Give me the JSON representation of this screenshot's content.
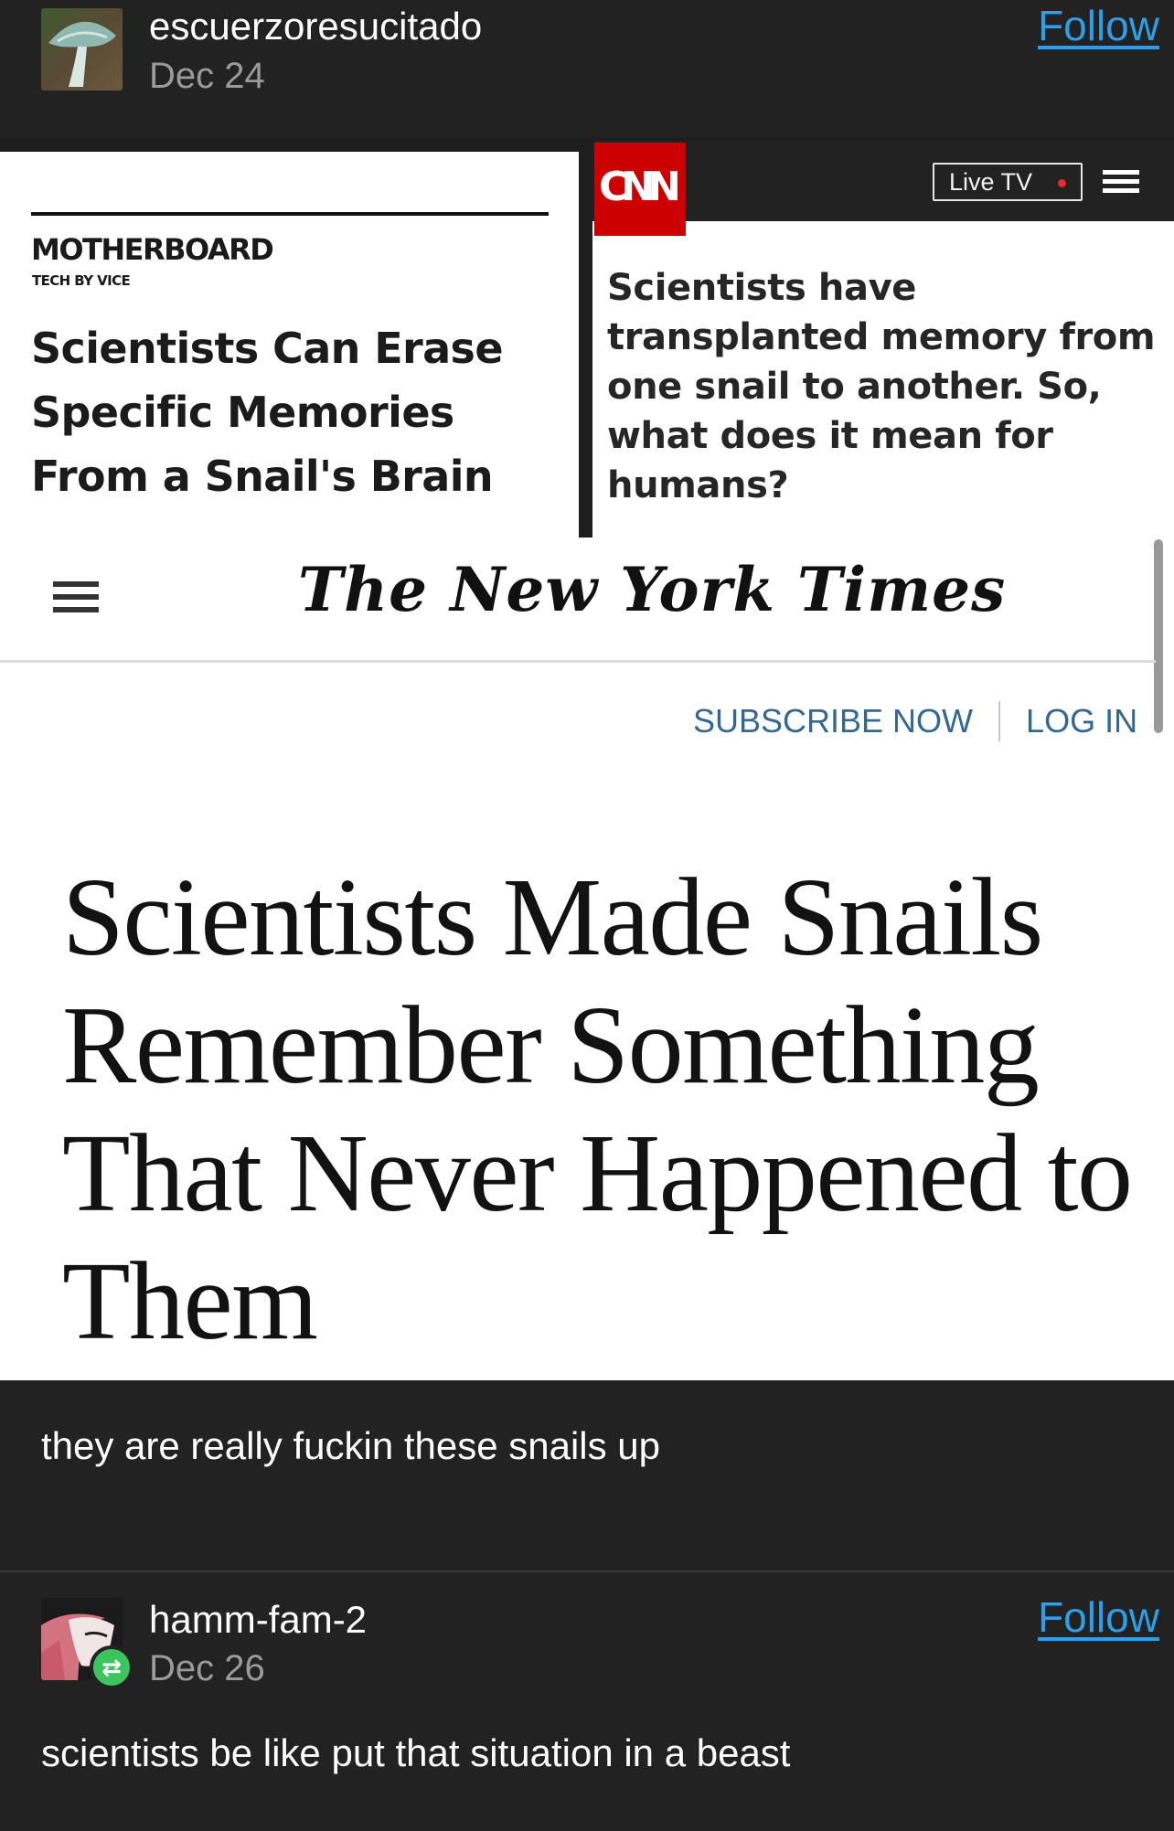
{
  "post": {
    "username": "escuerzoresucitado",
    "date": "Dec 24",
    "follow_label": "Follow"
  },
  "motherboard": {
    "logo": "MOTHERBOARD",
    "sublogo": "TECH BY VICE",
    "headline": "Scientists Can Erase Specific Memories From a Snail's Brain"
  },
  "cnn": {
    "logo": "CNN",
    "live_tv_label": "Live TV",
    "headline": "Scientists have transplanted memory from one snail to another. So, what does it mean for humans?"
  },
  "nyt": {
    "logo": "The New York Times",
    "subscribe_label": "SUBSCRIBE NOW",
    "login_label": "LOG IN",
    "headline": "Scientists Made Snails Remember Something That Never Happened to Them"
  },
  "caption": "they are really fuckin these snails up",
  "reblog": {
    "username": "hamm-fam-2",
    "date": "Dec 26",
    "follow_label": "Follow",
    "comment": "scientists be like put that situation in a beast"
  },
  "colors": {
    "background": "#222222",
    "follow_link": "#2f9ee8",
    "cnn_red": "#cc0000",
    "nyt_link": "#326891",
    "reblog_green": "#3cc55e"
  },
  "icons": [
    "mushroom-avatar",
    "hamburger-menu-icon",
    "live-dot-icon",
    "reblog-icon",
    "anime-avatar"
  ]
}
